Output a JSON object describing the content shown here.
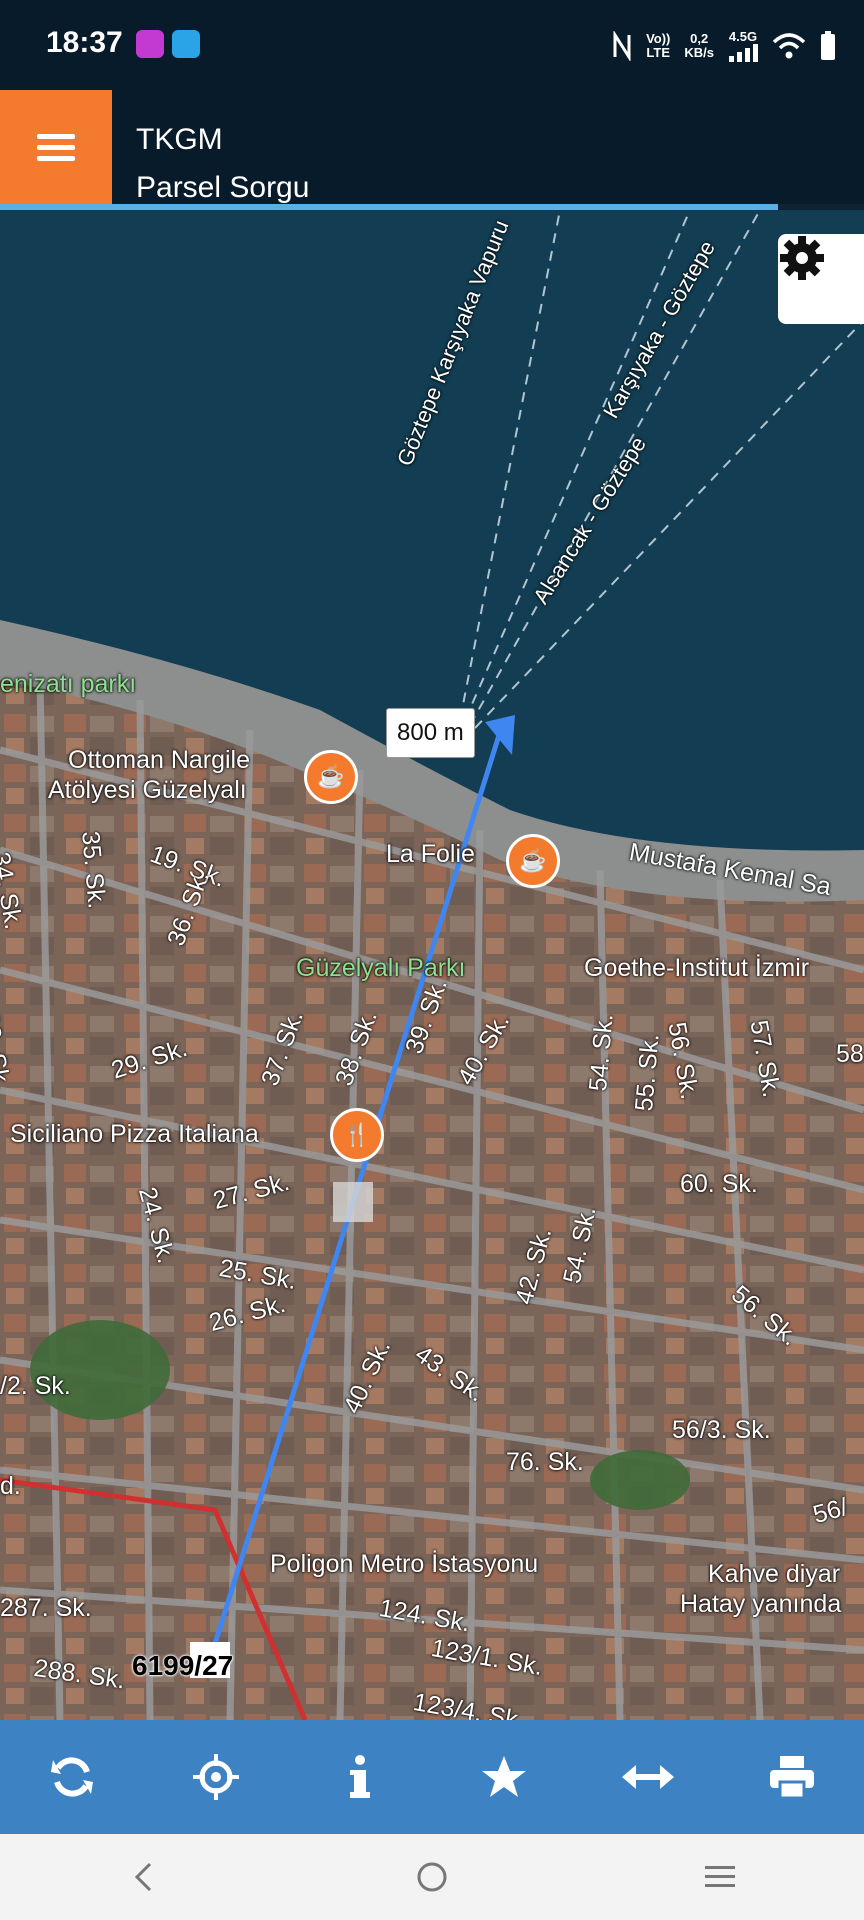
{
  "status": {
    "time": "18:37",
    "network": "LTE",
    "volte": "Vo))",
    "speed_value": "0,2",
    "speed_unit": "KB/s",
    "generation": "4.5G"
  },
  "header": {
    "title_line1": "TKGM",
    "title_line2": "Parsel Sorgu",
    "accent": "#f47a2e"
  },
  "map": {
    "distance_label": "800 m",
    "parcel_label": "6199/27",
    "labels": [
      {
        "text": "Göztepe Karşıyaka Vapuru"
      },
      {
        "text": "Karşıyaka - Göztepe"
      },
      {
        "text": "Alsancak - Göztepe"
      },
      {
        "text": "enizatı parkı"
      },
      {
        "text": "Ottoman Nargile"
      },
      {
        "text": "Atölyesi Güzelyalı"
      },
      {
        "text": "La Folie"
      },
      {
        "text": "Mustafa Kemal Sa"
      },
      {
        "text": "Güzelyalı Parkı"
      },
      {
        "text": "Goethe-Institut İzmir"
      },
      {
        "text": "Siciliano Pizza Italiana"
      },
      {
        "text": "Poligon Metro İstasyonu"
      },
      {
        "text": "Kahve diyar"
      },
      {
        "text": "Hatay yanında"
      },
      {
        "text": "19. Sk."
      },
      {
        "text": "34. Sk."
      },
      {
        "text": "35. Sk."
      },
      {
        "text": "36. Sk."
      },
      {
        "text": "22. Sk."
      },
      {
        "text": "29. Sk."
      },
      {
        "text": "37. Sk."
      },
      {
        "text": "38. Sk."
      },
      {
        "text": "39. Sk."
      },
      {
        "text": "40. Sk."
      },
      {
        "text": "54. Sk."
      },
      {
        "text": "55. Sk."
      },
      {
        "text": "56. Sk."
      },
      {
        "text": "57. Sk."
      },
      {
        "text": "58"
      },
      {
        "text": "60. Sk."
      },
      {
        "text": "24. Sk."
      },
      {
        "text": "27. Sk."
      },
      {
        "text": "25. Sk."
      },
      {
        "text": "26. Sk."
      },
      {
        "text": "42. Sk."
      },
      {
        "text": "54. Sk."
      },
      {
        "text": "56. Sk."
      },
      {
        "text": "/2. Sk."
      },
      {
        "text": "40. Sk."
      },
      {
        "text": "43. Sk."
      },
      {
        "text": "56/3. Sk."
      },
      {
        "text": "76. Sk."
      },
      {
        "text": "56/"
      },
      {
        "text": "287. Sk."
      },
      {
        "text": "124. Sk."
      },
      {
        "text": "123/1. Sk."
      },
      {
        "text": "288. Sk."
      },
      {
        "text": "123/4. Sk."
      },
      {
        "text": "d."
      }
    ]
  },
  "toolbar": {
    "buttons": [
      "refresh-icon",
      "crosshair-icon",
      "info-icon",
      "star-icon",
      "measure-icon",
      "print-icon"
    ],
    "color": "#3d82c2"
  },
  "nav": {
    "buttons": [
      "back-icon",
      "home-icon",
      "menu-icon"
    ]
  }
}
